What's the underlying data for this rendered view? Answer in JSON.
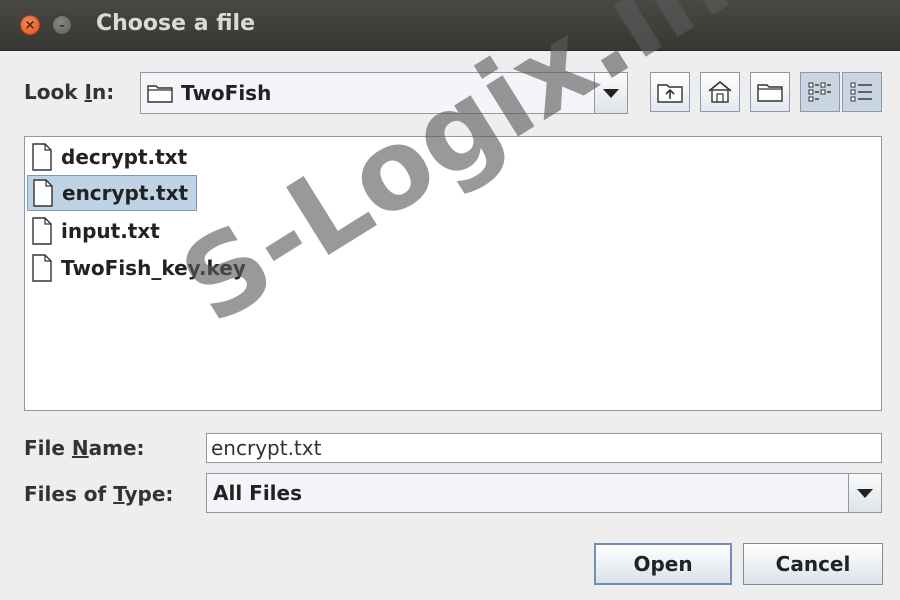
{
  "window": {
    "title": "Choose a file",
    "close_glyph": "×",
    "minimize_glyph": "–"
  },
  "look_in": {
    "label_pre": "Look ",
    "label_mnemonic": "I",
    "label_post": "n:",
    "value": "TwoFish",
    "icon": "folder-icon"
  },
  "toolbar": {
    "buttons": [
      {
        "name": "up-one-level",
        "icon": "folder-up-icon"
      },
      {
        "name": "home",
        "icon": "home-icon"
      },
      {
        "name": "new-folder",
        "icon": "new-folder-icon"
      },
      {
        "name": "list-view",
        "icon": "list-view-icon",
        "active": true
      },
      {
        "name": "details-view",
        "icon": "details-view-icon",
        "active": true
      }
    ]
  },
  "files": [
    {
      "name": "decrypt.txt",
      "selected": false
    },
    {
      "name": "encrypt.txt",
      "selected": true
    },
    {
      "name": "input.txt",
      "selected": false
    },
    {
      "name": "TwoFish_key.key",
      "selected": false
    }
  ],
  "file_name": {
    "label_pre": "File ",
    "label_mnemonic": "N",
    "label_post": "ame:",
    "value": "encrypt.txt"
  },
  "file_type": {
    "label_pre": "Files of ",
    "label_mnemonic": "T",
    "label_post": "ype:",
    "value": "All Files"
  },
  "buttons": {
    "open": "Open",
    "cancel": "Cancel"
  },
  "watermark": "S-Logix.in",
  "colors": {
    "titlebar": "#3c3b37",
    "close": "#e95420",
    "selection": "#bfd2e6"
  }
}
